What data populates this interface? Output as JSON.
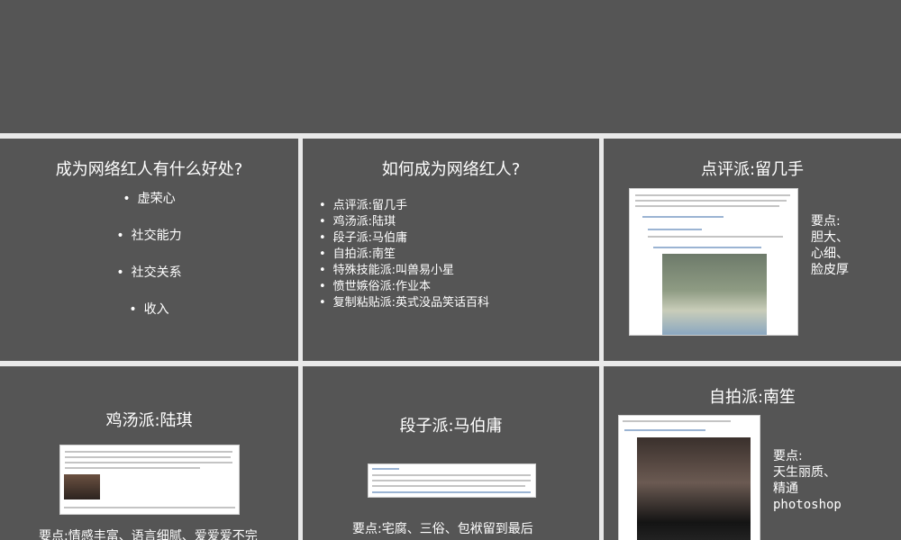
{
  "slide1": {
    "title": "成为网络红人有什么好处?",
    "items": [
      "虚荣心",
      "社交能力",
      "社交关系",
      "收入"
    ]
  },
  "slide2": {
    "title": "如何成为网络红人?",
    "items": [
      "点评派:留几手",
      "鸡汤派:陆琪",
      "段子派:马伯庸",
      "自拍派:南笙",
      "特殊技能派:叫兽易小星",
      "愤世嫉俗派:作业本",
      "复制粘贴派:英式没品笑话百科"
    ]
  },
  "slide3": {
    "title": "点评派:留几手",
    "notes": [
      "要点:",
      "胆大、",
      "心细、",
      "脸皮厚"
    ]
  },
  "slide4": {
    "title": "鸡汤派:陆琪",
    "notes": "要点:情感丰富、语言细腻、爱爱爱不完"
  },
  "slide5": {
    "title": "段子派:马伯庸",
    "notes": "要点:宅腐、三俗、包袱留到最后"
  },
  "slide6": {
    "title": "自拍派:南笙",
    "notes": [
      "要点:",
      "天生丽质、",
      "精通",
      "photoshop"
    ]
  }
}
